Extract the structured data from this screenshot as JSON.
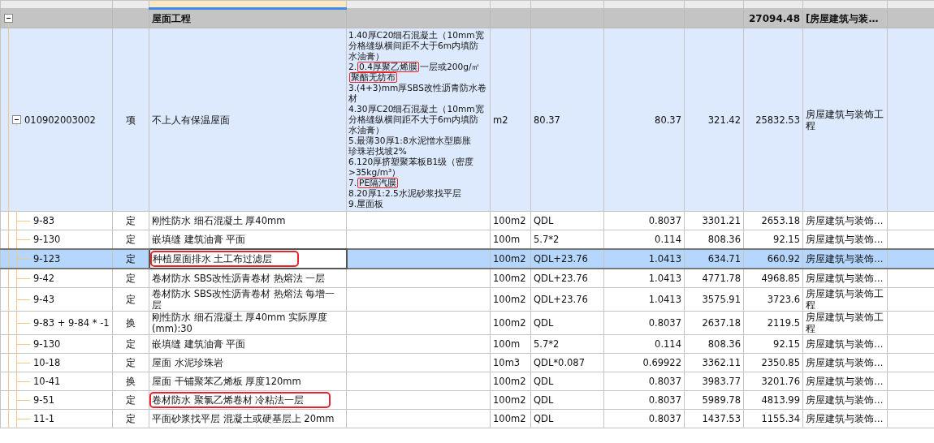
{
  "header_cells": [
    {
      "selected": false
    },
    {
      "selected": false
    },
    {
      "selected": true
    },
    {
      "selected": false
    },
    {
      "selected": false
    },
    {
      "selected": false
    },
    {
      "selected": false
    },
    {
      "selected": false
    },
    {
      "selected": false
    },
    {
      "selected": false
    },
    {
      "selected": false
    }
  ],
  "group": {
    "expanded": true,
    "name": "屋面工程",
    "total": "27094.48",
    "fee_file": "[房屋建筑与装…"
  },
  "item": {
    "expanded": true,
    "code": "010902003002",
    "type": "项",
    "name": "不上人有保温屋面",
    "unit": "m2",
    "expression": "80.37",
    "quantity": "80.37",
    "unit_price": "321.42",
    "total": "25832.53",
    "fee_file": "房屋建筑与装饰工程",
    "features": [
      [
        {
          "text": "1.40厚C20细石混凝土（10mm宽",
          "marked": false
        }
      ],
      [
        {
          "text": "分格缝纵横间距不大于6m内填防",
          "marked": false
        }
      ],
      [
        {
          "text": "水油膏）",
          "marked": false
        }
      ],
      [
        {
          "text": "2.",
          "marked": false
        },
        {
          "text": "0.4厚聚乙烯膜",
          "marked": true
        },
        {
          "text": "一层或200g/㎡",
          "marked": false
        }
      ],
      [
        {
          "text": "聚酯无纺布",
          "marked": true
        }
      ],
      [
        {
          "text": "3.(4+3)mm厚SBS改性沥青防水卷",
          "marked": false
        }
      ],
      [
        {
          "text": "材",
          "marked": false
        }
      ],
      [
        {
          "text": "4.30厚C20细石混凝土（10mm宽",
          "marked": false
        }
      ],
      [
        {
          "text": "分格缝纵横间距不大于6m内填防",
          "marked": false
        }
      ],
      [
        {
          "text": "水油膏）",
          "marked": false
        }
      ],
      [
        {
          "text": "5.最薄30厚1:8水泥憎水型膨胀",
          "marked": false
        }
      ],
      [
        {
          "text": "珍珠岩找坡2%",
          "marked": false
        }
      ],
      [
        {
          "text": "6.120厚挤塑聚苯板B1级（密度",
          "marked": false
        }
      ],
      [
        {
          "text": ">35kg/m³）",
          "marked": false
        }
      ],
      [
        {
          "text": "7.",
          "marked": false
        },
        {
          "text": "PE隔汽膜",
          "marked": true
        }
      ],
      [
        {
          "text": "8.20厚1:2.5水泥砂浆找平层",
          "marked": false
        }
      ],
      [
        {
          "text": "9.屋面板",
          "marked": false
        }
      ]
    ]
  },
  "rows": [
    {
      "code": "9-83",
      "type": "定",
      "name": "刚性防水 细石混凝土 厚40mm",
      "unit": "100m2",
      "expression": "QDL",
      "quantity": "0.8037",
      "unit_price": "3301.21",
      "total": "2653.18",
      "fee_file": "房屋建筑与装饰…",
      "selected": false,
      "marked": false
    },
    {
      "code": "9-130",
      "type": "定",
      "name": "嵌填缝 建筑油膏 平面",
      "unit": "100m",
      "expression": "5.7*2",
      "quantity": "0.114",
      "unit_price": "808.36",
      "total": "92.15",
      "fee_file": "房屋建筑与装饰…",
      "selected": false,
      "marked": false
    },
    {
      "code": "9-123",
      "type": "定",
      "name": "种植屋面排水 土工布过滤层",
      "unit": "100m2",
      "expression": "QDL+23.76",
      "quantity": "1.0413",
      "unit_price": "634.71",
      "total": "660.92",
      "fee_file": "房屋建筑与装饰…",
      "selected": true,
      "marked": true
    },
    {
      "code": "9-42",
      "type": "定",
      "name": "卷材防水 SBS改性沥青卷材 热熔法 一层",
      "unit": "100m2",
      "expression": "QDL+23.76",
      "quantity": "1.0413",
      "unit_price": "4771.78",
      "total": "4968.85",
      "fee_file": "房屋建筑与装饰…",
      "selected": false,
      "marked": false
    },
    {
      "code": "9-43",
      "type": "定",
      "name": "卷材防水 SBS改性沥青卷材 热熔法 每增一层",
      "unit": "100m2",
      "expression": "QDL+23.76",
      "quantity": "1.0413",
      "unit_price": "3575.91",
      "total": "3723.6",
      "fee_file": "房屋建筑与装饰工程",
      "selected": false,
      "marked": false
    },
    {
      "code": "9-83 + 9-84 * -1",
      "type": "换",
      "name": "刚性防水 细石混凝土 厚40mm  实际厚度(mm):30",
      "unit": "100m2",
      "expression": "QDL",
      "quantity": "0.8037",
      "unit_price": "2637.18",
      "total": "2119.5",
      "fee_file": "房屋建筑与装饰工程",
      "selected": false,
      "marked": false
    },
    {
      "code": "9-130",
      "type": "定",
      "name": "嵌填缝 建筑油膏 平面",
      "unit": "100m",
      "expression": "5.7*2",
      "quantity": "0.114",
      "unit_price": "808.36",
      "total": "92.15",
      "fee_file": "房屋建筑与装饰…",
      "selected": false,
      "marked": false
    },
    {
      "code": "10-18",
      "type": "定",
      "name": "屋面 水泥珍珠岩",
      "unit": "10m3",
      "expression": "QDL*0.087",
      "quantity": "0.69922",
      "unit_price": "3362.11",
      "total": "2350.85",
      "fee_file": "房屋建筑与装饰…",
      "selected": false,
      "marked": false
    },
    {
      "code": "10-41",
      "type": "换",
      "name": "屋面 干铺聚苯乙烯板 厚度120mm",
      "unit": "100m2",
      "expression": "QDL",
      "quantity": "0.8037",
      "unit_price": "3983.77",
      "total": "3201.76",
      "fee_file": "房屋建筑与装饰…",
      "selected": false,
      "marked": false
    },
    {
      "code": "9-51",
      "type": "定",
      "name": "卷材防水 聚氯乙烯卷材 冷粘法一层",
      "unit": "100m2",
      "expression": "QDL",
      "quantity": "0.8037",
      "unit_price": "5989.78",
      "total": "4813.99",
      "fee_file": "房屋建筑与装饰…",
      "selected": false,
      "marked": true
    },
    {
      "code": "11-1",
      "type": "定",
      "name": "平面砂浆找平层 混凝土或硬基层上 20mm",
      "unit": "100m2",
      "expression": "QDL",
      "quantity": "0.8037",
      "unit_price": "1437.53",
      "total": "1155.34",
      "fee_file": "房屋建筑与装饰…",
      "selected": false,
      "marked": false
    }
  ]
}
